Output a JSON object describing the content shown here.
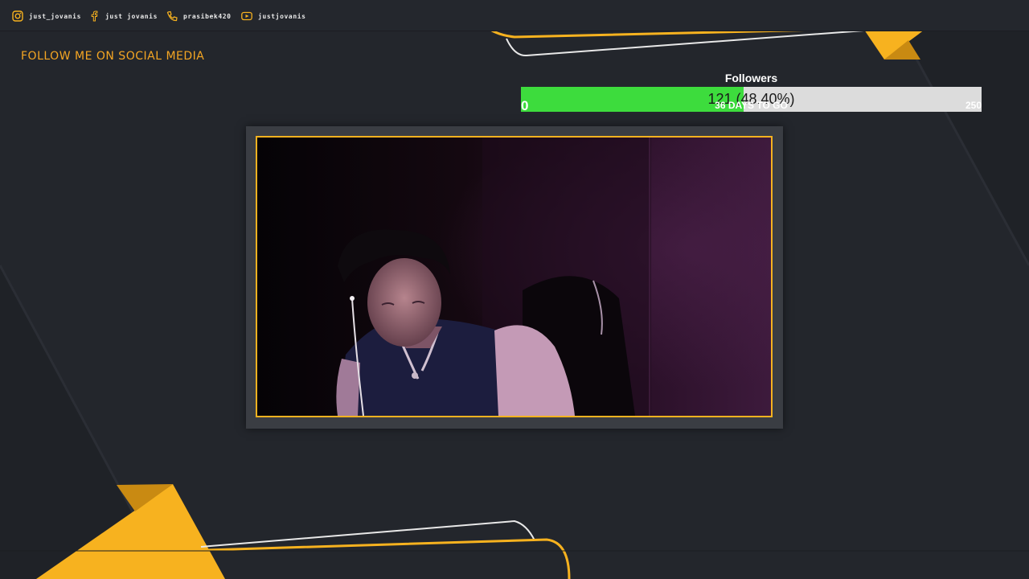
{
  "colors": {
    "background": "#23262c",
    "accent": "#f7b21f",
    "follow_text": "#f5a623",
    "goal_fill": "#3ddc3d",
    "goal_track": "#dcdcdc"
  },
  "social": [
    {
      "icon": "instagram-icon",
      "label": "just_jovanis"
    },
    {
      "icon": "facebook-icon",
      "label": "just jovanis"
    },
    {
      "icon": "phone-icon",
      "label": "prasibek420"
    },
    {
      "icon": "youtube-icon",
      "label": "justjovanis"
    }
  ],
  "follow_text": "FOLLOW ME ON SOCIAL MEDIA",
  "goal": {
    "title": "Followers",
    "current": 121,
    "target": 250,
    "value_text": "121 (48.40%)",
    "fill_fraction": 0.484,
    "min_label": "0",
    "days_label": "36 DAYS TO GO",
    "max_label": "250"
  },
  "webcam": {
    "subject": "streamer-webcam-feed"
  }
}
